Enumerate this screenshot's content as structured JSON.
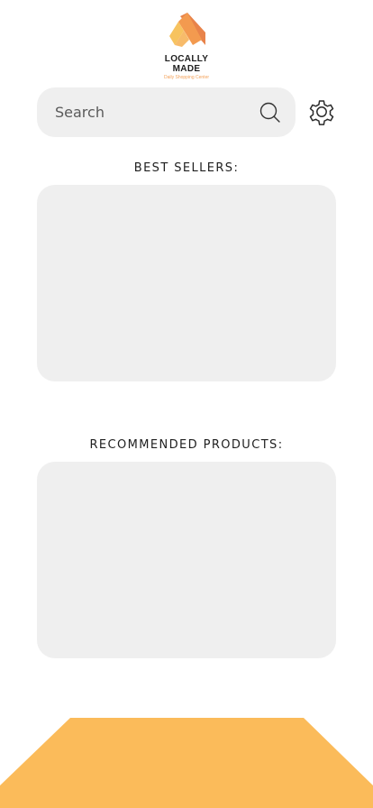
{
  "logo": {
    "line1": "LOCALLY",
    "line2": "MADE",
    "tagline": "Daily Shopping Center",
    "colors": {
      "light": "#f7c35f",
      "mid": "#f39a4f",
      "dark": "#e8834a"
    }
  },
  "search": {
    "placeholder": "Search",
    "icon": "search-icon"
  },
  "settings": {
    "icon": "gear-icon"
  },
  "sections": {
    "best_sellers": "BEST SELLERS:",
    "recommended": "RECOMMENDED PRODUCTS:"
  },
  "colors": {
    "panel": "#efefef",
    "accent": "#fbbb5a"
  }
}
